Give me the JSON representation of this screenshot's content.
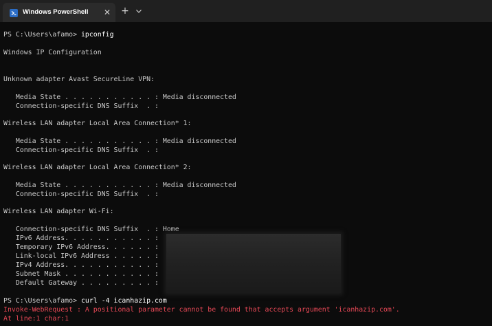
{
  "tab": {
    "title": "Windows PowerShell",
    "icon": "powershell-icon",
    "close_glyph": "✕",
    "newtab_glyph": "+"
  },
  "colors": {
    "terminal_bg": "#0c0c0c",
    "text": "#cccccc",
    "command": "#ffffff",
    "error": "#e74856",
    "tabbar_bg": "#202020",
    "tab_bg": "#2b2b2b"
  },
  "terminal": {
    "prompt1": "PS C:\\Users\\afamo> ",
    "cmd1": "ipconfig",
    "heading": "Windows IP Configuration",
    "adapter1": "Unknown adapter Avast SecureLine VPN:",
    "a1_media": "   Media State . . . . . . . . . . . : Media disconnected",
    "a1_dns": "   Connection-specific DNS Suffix  . :",
    "adapter2": "Wireless LAN adapter Local Area Connection* 1:",
    "a2_media": "   Media State . . . . . . . . . . . : Media disconnected",
    "a2_dns": "   Connection-specific DNS Suffix  . :",
    "adapter3": "Wireless LAN adapter Local Area Connection* 2:",
    "a3_media": "   Media State . . . . . . . . . . . : Media disconnected",
    "a3_dns": "   Connection-specific DNS Suffix  . :",
    "adapter4": "Wireless LAN adapter Wi-Fi:",
    "wifi_dns": "   Connection-specific DNS Suffix  . : Home",
    "wifi_ipv6": "   IPv6 Address. . . . . . . . . . . :",
    "wifi_tmp_ipv6": "   Temporary IPv6 Address. . . . . . :",
    "wifi_link_ipv6": "   Link-local IPv6 Address . . . . . :",
    "wifi_ipv4": "   IPv4 Address. . . . . . . . . . . :",
    "wifi_mask": "   Subnet Mask . . . . . . . . . . . :",
    "wifi_gateway": "   Default Gateway . . . . . . . . . :",
    "prompt2": "PS C:\\Users\\afamo> ",
    "cmd2": "curl -4 icanhazip.com",
    "error1": "Invoke-WebRequest : A positional parameter cannot be found that accepts argument 'icanhazip.com'.",
    "error2": "At line:1 char:1"
  }
}
